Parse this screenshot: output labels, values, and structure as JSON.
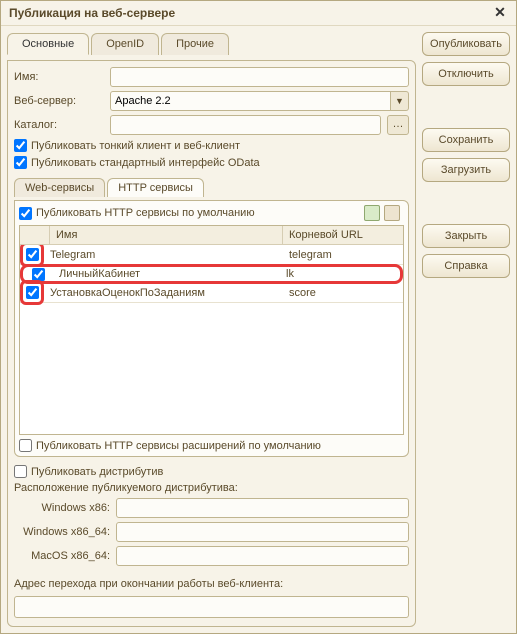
{
  "title": "Публикация на веб-сервере",
  "main_tabs": [
    "Основные",
    "OpenID",
    "Прочие"
  ],
  "active_main_tab": 0,
  "fields": {
    "name_label": "Имя:",
    "name_value": "",
    "webserver_label": "Веб-сервер:",
    "webserver_value": "Apache 2.2",
    "catalog_label": "Каталог:",
    "catalog_value": ""
  },
  "checks": {
    "thin_client": {
      "label": "Публиковать тонкий клиент и веб-клиент",
      "checked": true
    },
    "odata": {
      "label": "Публиковать стандартный интерфейс OData",
      "checked": true
    }
  },
  "sub_tabs": [
    "Web-сервисы",
    "HTTP сервисы"
  ],
  "active_sub_tab": 1,
  "http": {
    "default_label": "Публиковать HTTP сервисы по умолчанию",
    "default_checked": true,
    "columns": {
      "name": "Имя",
      "url": "Корневой URL"
    },
    "rows": [
      {
        "checked": true,
        "name": "Telegram",
        "url": "telegram",
        "hl_check": true
      },
      {
        "checked": true,
        "name": "ЛичныйКабинет",
        "url": "lk",
        "hl_row": true
      },
      {
        "checked": true,
        "name": "УстановкаОценокПоЗаданиям",
        "url": "score",
        "hl_check": true
      }
    ],
    "ext_label": "Публиковать HTTP сервисы расширений по умолчанию",
    "ext_checked": false
  },
  "distrib": {
    "publish_label": "Публиковать дистрибутив",
    "publish_checked": false,
    "location_label": "Расположение публикуемого дистрибутива:",
    "win86_label": "Windows x86:",
    "win64_label": "Windows x86_64:",
    "mac_label": "MacOS x86_64:"
  },
  "addr_label": "Адрес перехода при окончании работы веб-клиента:",
  "buttons": {
    "publish": "Опубликовать",
    "disconnect": "Отключить",
    "save": "Сохранить",
    "load": "Загрузить",
    "close": "Закрыть",
    "help": "Справка"
  }
}
